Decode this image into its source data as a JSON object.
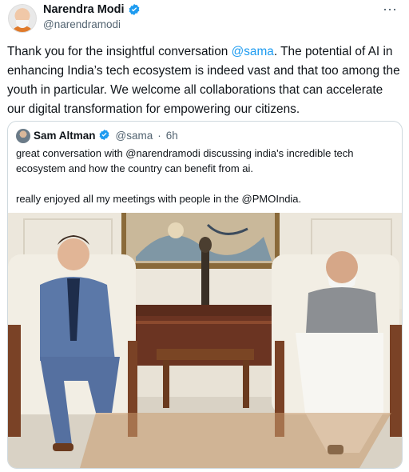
{
  "author": {
    "name": "Narendra Modi",
    "handle": "@narendramodi",
    "avatar_icon": "profile-photo",
    "verified_icon": "verified-badge-icon"
  },
  "more_icon": "more-options-icon",
  "tweet": {
    "text_before": "Thank you for the insightful conversation ",
    "mention": "@sama",
    "text_after": ". The potential of AI in enhancing India’s tech ecosystem is indeed vast and that too among the youth in particular. We welcome all collaborations that can accelerate our digital transformation for empowering our citizens."
  },
  "quoted": {
    "name": "Sam Altman",
    "handle": "@sama",
    "separator": "·",
    "time": "6h",
    "line1": "great conversation with @narendramodi discussing india's incredible tech ecosystem and how the country can benefit from ai.",
    "line2": "really enjoyed all my meetings with people in the @PMOIndia."
  },
  "colors": {
    "link": "#1d9bf0",
    "verified": "#1d9bf0",
    "secondary_text": "#536471"
  }
}
